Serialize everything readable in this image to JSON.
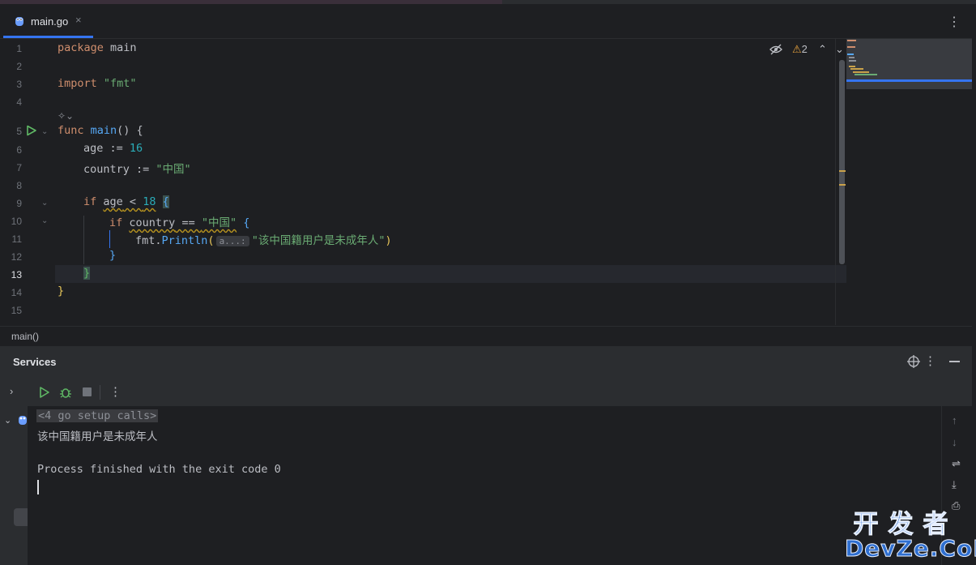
{
  "tab": {
    "label": "main.go",
    "close": "×"
  },
  "tabbar": {
    "more": "⋮"
  },
  "editor_toolbar": {
    "warning_count": "2"
  },
  "code": {
    "line_numbers": [
      "1",
      "2",
      "3",
      "4",
      "5",
      "6",
      "7",
      "8",
      "9",
      "10",
      "11",
      "12",
      "13",
      "14",
      "15"
    ],
    "active_line": "13",
    "lines": {
      "l1_kw": "package",
      "l1_name": "main",
      "l3_kw": "import",
      "l3_str": "\"fmt\"",
      "l5_kw": "func",
      "l5_fn": "main",
      "l5_rest": "() {",
      "l6_var": "age",
      "l6_op": " := ",
      "l6_num": "16",
      "l7_var": "country",
      "l7_op": " := ",
      "l7_str": "\"中国\"",
      "l9_kw": "if",
      "l9_var": "age",
      "l9_op": " < ",
      "l9_num": "18",
      "l9_brace": "{",
      "l10_kw": "if",
      "l10_var": "country",
      "l10_op": " == ",
      "l10_str": "\"中国\"",
      "l10_brace": "{",
      "l11_pkg": "fmt.",
      "l11_fn": "Println",
      "l11_open": "(",
      "l11_hint": "a...:",
      "l11_str": "\"该中国籍用户是未成年人\"",
      "l11_close": ")",
      "l12_brace": "}",
      "l13_brace": "}",
      "l14_brace": "}"
    }
  },
  "breadcrumb": "main()",
  "services": {
    "title": "Services",
    "console": {
      "setup_calls": "<4 go setup calls>",
      "output_line": "该中国籍用户是未成年人",
      "exit_line": "Process finished with the exit code 0"
    }
  },
  "watermark": {
    "cn": "开发者",
    "en": "DevZe.CoM"
  },
  "colors": {
    "background": "#1e1f22",
    "panel": "#2b2d30",
    "accent": "#3574f0",
    "keyword": "#cf8e6d",
    "function": "#56a8f5",
    "string": "#6aab73",
    "number": "#2aacb8",
    "warning": "#e8a33d",
    "run_green": "#5fb865"
  }
}
